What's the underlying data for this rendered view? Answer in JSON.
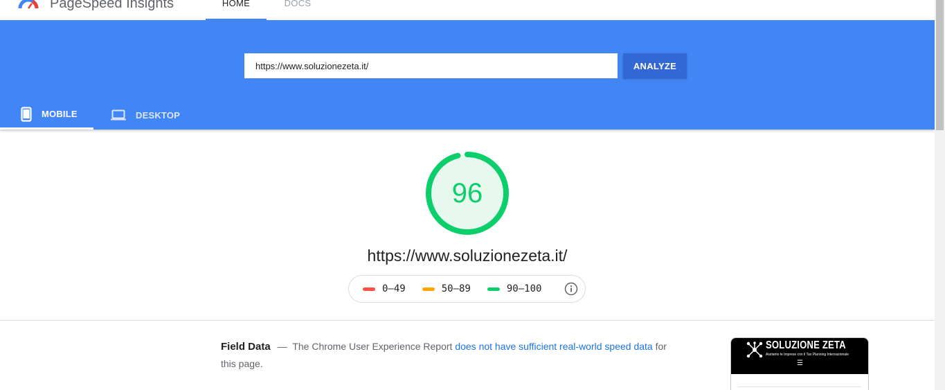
{
  "app": {
    "title": "PageSpeed Insights"
  },
  "nav": {
    "home": "HOME",
    "docs": "DOCS"
  },
  "search": {
    "url": "https://www.soluzionezeta.it/",
    "button": "ANALYZE"
  },
  "device_tabs": {
    "mobile": "MOBILE",
    "desktop": "DESKTOP",
    "active": "mobile"
  },
  "score": {
    "value": "96",
    "fraction": 0.96,
    "color": "#0cce6b"
  },
  "page_url": "https://www.soluzionezeta.it/",
  "legend": [
    {
      "label": "0–49",
      "color": "#ff4e42"
    },
    {
      "label": "50–89",
      "color": "#ffa400"
    },
    {
      "label": "90–100",
      "color": "#0cce6b"
    }
  ],
  "field_data": {
    "title": "Field Data",
    "dash": "—",
    "text_before": "The Chrome User Experience Report",
    "link_text": "does not have sufficient real-world speed data",
    "text_after": "for this page."
  },
  "thumbnail": {
    "brand": "SOLUZIONE ZETA",
    "tagline": "Aiutiamo le Imprese con il Tax Planning Internazionale"
  },
  "colors": {
    "header_blue": "#4285f4",
    "button_blue": "#3367d6",
    "link": "#1a73e8"
  }
}
